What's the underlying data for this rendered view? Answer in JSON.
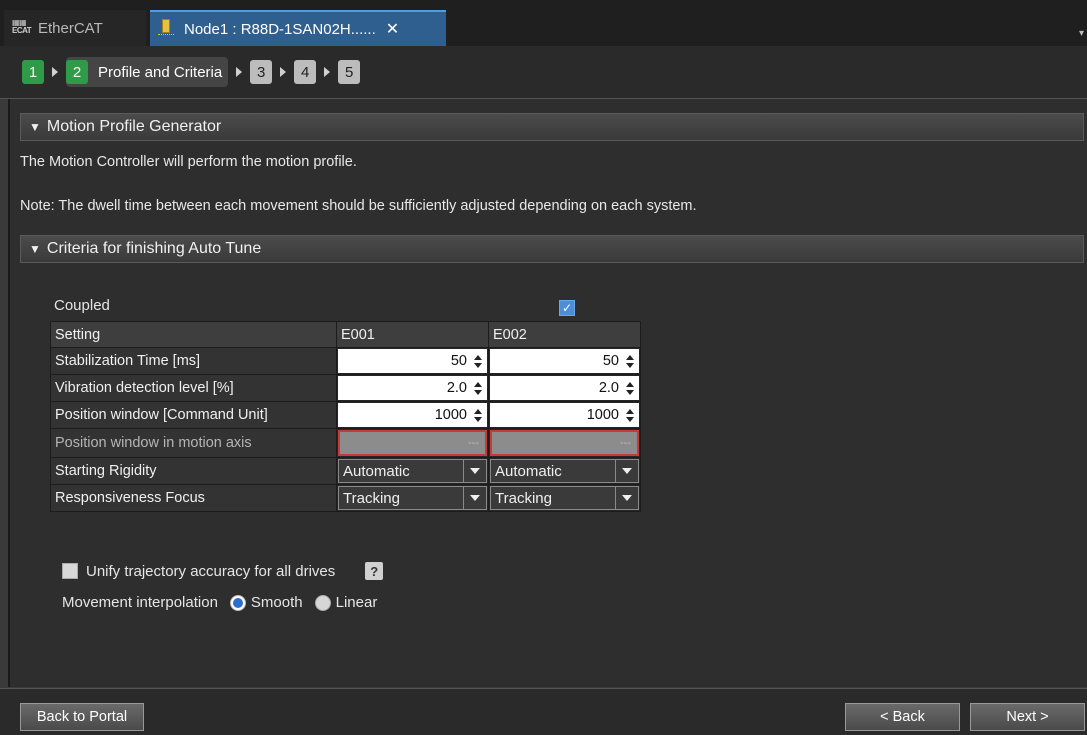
{
  "tabs": [
    {
      "label": "EtherCAT",
      "icon": "ecat-icon"
    },
    {
      "label": "Node1 : R88D-1SAN02H......",
      "icon": "node-icon",
      "close": "✕"
    }
  ],
  "steps": {
    "s1": "1",
    "s2": "2",
    "s2_label": "Profile and Criteria",
    "s3": "3",
    "s4": "4",
    "s5": "5"
  },
  "motion": {
    "header": "Motion Profile Generator",
    "line1": "The Motion Controller will perform the motion profile.",
    "line2": "Note: The dwell time between each movement should be sufficiently adjusted depending on each system."
  },
  "criteria": {
    "header": "Criteria for finishing Auto Tune",
    "coupled_label": "Coupled",
    "coupled_checked": true,
    "table": {
      "headers": [
        "Setting",
        "E001",
        "E002"
      ],
      "rows": [
        {
          "label": "Stabilization Time [ms]",
          "e001": "50",
          "e002": "50"
        },
        {
          "label": "Vibration detection level [%]",
          "e001": "2.0",
          "e002": "2.0"
        },
        {
          "label": "Position window [Command Unit]",
          "e001": "1000",
          "e002": "1000"
        },
        {
          "label": "Position window in motion axis",
          "e001": "---",
          "e002": "---"
        },
        {
          "label": "Starting Rigidity",
          "e001": "Automatic",
          "e002": "Automatic"
        },
        {
          "label": "Responsiveness Focus",
          "e001": "Tracking",
          "e002": "Tracking"
        }
      ]
    },
    "unify_label": "Unify trajectory accuracy for all drives",
    "unify_checked": false,
    "help": "?",
    "interp_label": "Movement interpolation",
    "interp_options": [
      "Smooth",
      "Linear"
    ],
    "interp_selected": "Smooth"
  },
  "footer": {
    "portal": "Back to Portal",
    "back": "< Back",
    "next": "Next >"
  },
  "colors": {
    "step_done": "#2f9a47",
    "accent": "#2c6fcc",
    "error_border": "#c63a3a"
  }
}
